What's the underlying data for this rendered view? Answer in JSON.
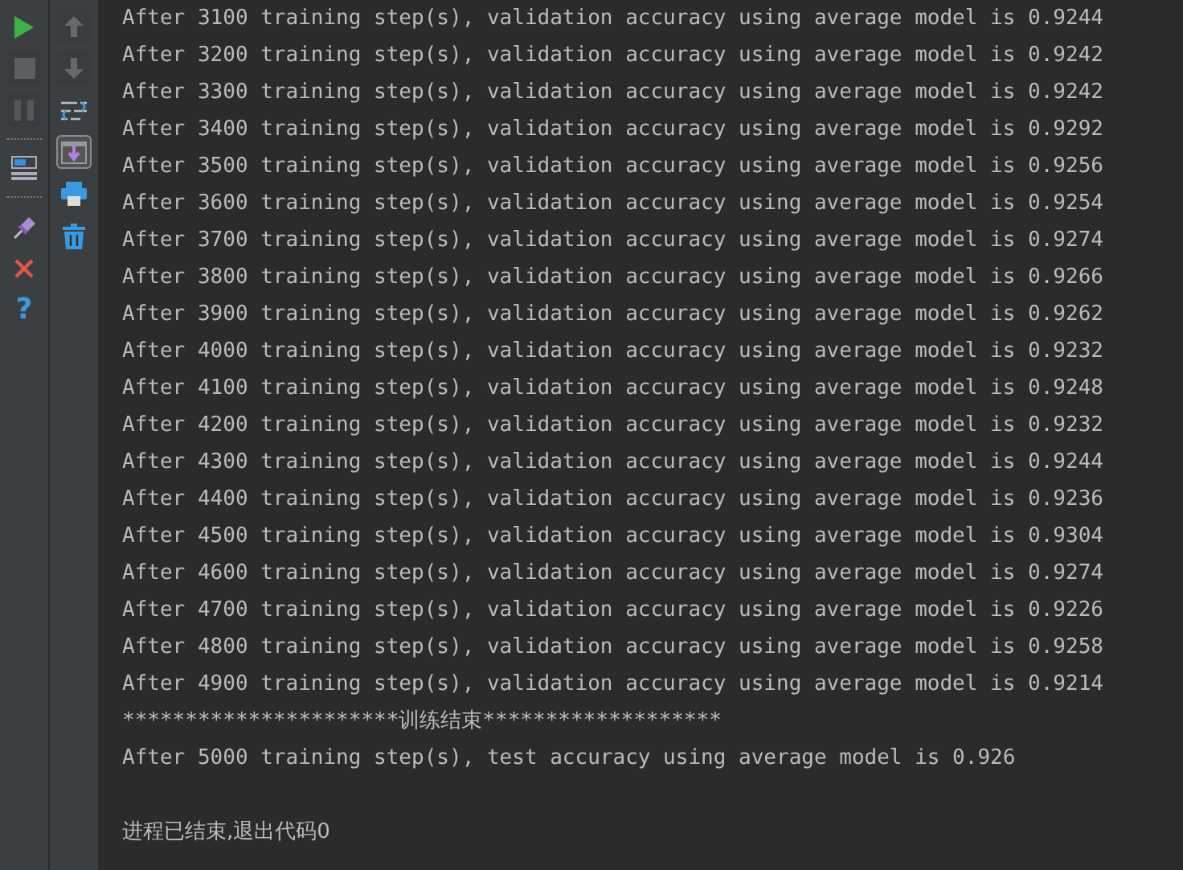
{
  "left_toolbar": [
    {
      "kind": "run",
      "disabled": false
    },
    {
      "kind": "stop",
      "disabled": true
    },
    {
      "kind": "pause",
      "disabled": true
    },
    {
      "kind": "separator"
    },
    {
      "kind": "layout",
      "disabled": false
    },
    {
      "kind": "separator"
    },
    {
      "kind": "pin",
      "disabled": false
    },
    {
      "kind": "close",
      "disabled": false
    },
    {
      "kind": "help",
      "disabled": false,
      "glyph": "?"
    }
  ],
  "right_toolbar": [
    {
      "kind": "up",
      "disabled": true,
      "selected": false
    },
    {
      "kind": "down",
      "disabled": true,
      "selected": false
    },
    {
      "kind": "wrap",
      "disabled": false,
      "selected": false
    },
    {
      "kind": "scroll-end",
      "disabled": false,
      "selected": true
    },
    {
      "kind": "print",
      "disabled": false,
      "selected": false
    },
    {
      "kind": "trash",
      "disabled": false,
      "selected": false
    }
  ],
  "output": [
    "After 3100 training step(s), validation accuracy using average model is 0.9244",
    "After 3200 training step(s), validation accuracy using average model is 0.9242",
    "After 3300 training step(s), validation accuracy using average model is 0.9242",
    "After 3400 training step(s), validation accuracy using average model is 0.9292",
    "After 3500 training step(s), validation accuracy using average model is 0.9256",
    "After 3600 training step(s), validation accuracy using average model is 0.9254",
    "After 3700 training step(s), validation accuracy using average model is 0.9274",
    "After 3800 training step(s), validation accuracy using average model is 0.9266",
    "After 3900 training step(s), validation accuracy using average model is 0.9262",
    "After 4000 training step(s), validation accuracy using average model is 0.9232",
    "After 4100 training step(s), validation accuracy using average model is 0.9248",
    "After 4200 training step(s), validation accuracy using average model is 0.9232",
    "After 4300 training step(s), validation accuracy using average model is 0.9244",
    "After 4400 training step(s), validation accuracy using average model is 0.9236",
    "After 4500 training step(s), validation accuracy using average model is 0.9304",
    "After 4600 training step(s), validation accuracy using average model is 0.9274",
    "After 4700 training step(s), validation accuracy using average model is 0.9226",
    "After 4800 training step(s), validation accuracy using average model is 0.9258",
    "After 4900 training step(s), validation accuracy using average model is 0.9214",
    "**********************训练结束*******************",
    "After 5000 training step(s), test accuracy using average model is 0.926"
  ],
  "exit_message": "进程已结束,退出代码0"
}
